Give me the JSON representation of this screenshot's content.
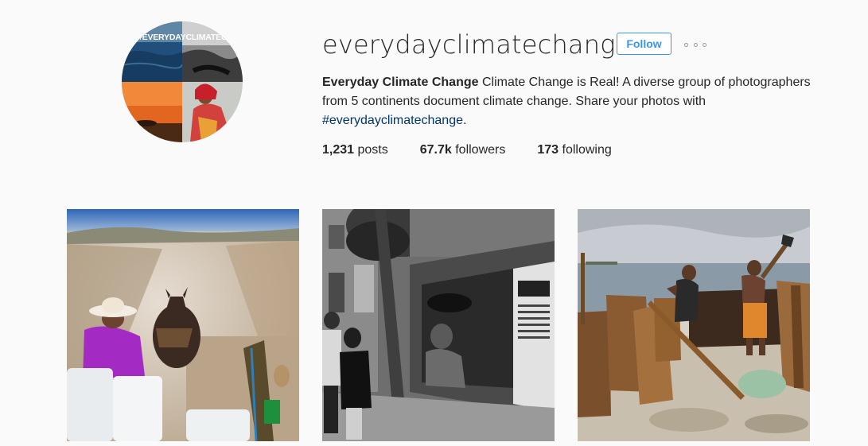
{
  "profile": {
    "username": "everydayclimatechange",
    "follow_label": "Follow",
    "avatar_tag": "#EVERYDAYCLIMATECHA",
    "more_icon": "more-horizontal-icon",
    "full_name": "Everyday Climate Change",
    "bio_text": " Climate Change is Real! A diverse group of photographers from 5 continents document climate change. Share your photos with ",
    "bio_hashtag": "#everydayclimatechange",
    "bio_end": "."
  },
  "stats": {
    "posts_count": "1,231",
    "posts_label": " posts",
    "followers_count": "67.7k",
    "followers_label": " followers",
    "following_count": "173",
    "following_label": " following"
  },
  "colors": {
    "accent": "#3897f0",
    "text": "#262626",
    "hashtag": "#003569",
    "background": "#fafafa"
  }
}
